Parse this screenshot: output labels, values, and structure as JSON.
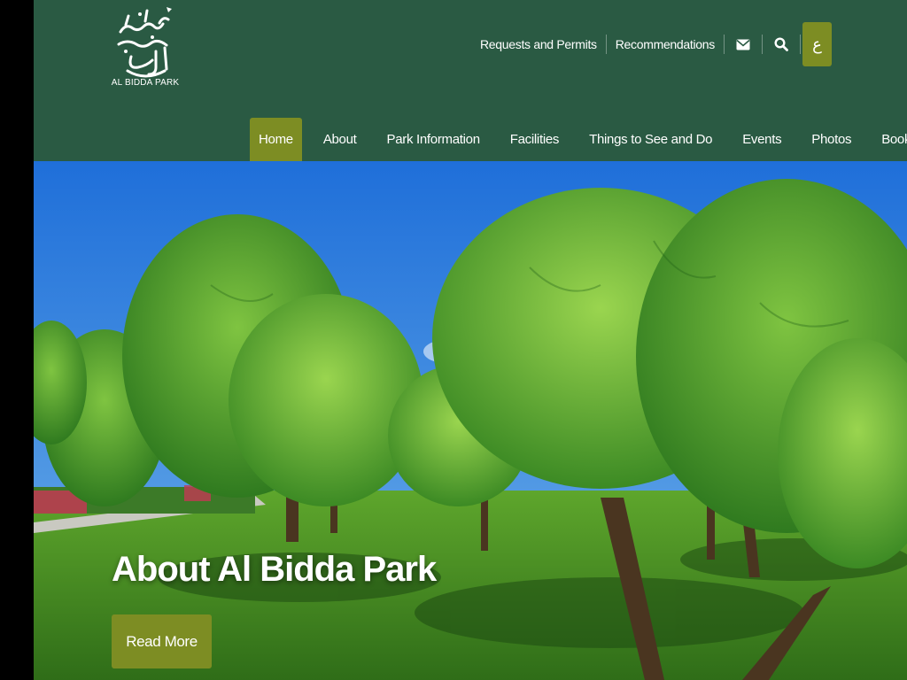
{
  "brand": {
    "logo_text": "AL BIDDA PARK",
    "primary_color": "#2a5a43",
    "accent_color": "#7d8d23"
  },
  "top_links": [
    {
      "label": "Requests and Permits"
    },
    {
      "label": "Recommendations"
    }
  ],
  "icons": {
    "mail": "envelope-icon",
    "search": "search-icon"
  },
  "language_toggle": {
    "label": "ع"
  },
  "nav": [
    {
      "label": "Home",
      "active": true
    },
    {
      "label": "About",
      "active": false
    },
    {
      "label": "Park Information",
      "active": false
    },
    {
      "label": "Facilities",
      "active": false
    },
    {
      "label": "Things to See and Do",
      "active": false
    },
    {
      "label": "Events",
      "active": false
    },
    {
      "label": "Photos",
      "active": false
    },
    {
      "label": "Booking",
      "active": false
    }
  ],
  "hero": {
    "title": "About Al Bidda Park",
    "button_label": "Read More"
  }
}
